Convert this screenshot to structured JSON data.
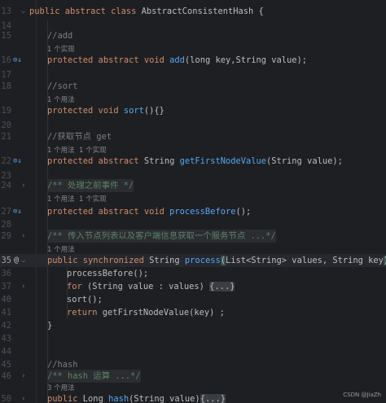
{
  "watermark": "CSDN @JiaZh",
  "lines": {
    "l13": {
      "num": "13",
      "kw1": "public abstract class ",
      "name": "AbstractConsistentHash {"
    },
    "l14": {
      "num": "14"
    },
    "l15": {
      "num": "15",
      "comment": "//add"
    },
    "hint_add": "1 个实现",
    "l16": {
      "num": "16",
      "kw": "protected abstract void ",
      "fn": "add",
      "rest": "(long key,String value);"
    },
    "l17": {
      "num": "17"
    },
    "l18": {
      "num": "18",
      "comment": "//sort"
    },
    "hint_sort": "1 个用法",
    "l19": {
      "num": "19",
      "kw": "protected void ",
      "fn": "sort",
      "rest": "(){}"
    },
    "l20": {
      "num": "20"
    },
    "l21": {
      "num": "21",
      "comment": "//获取节点 get"
    },
    "hint_get": "1 个用法  1 个实现",
    "l22": {
      "num": "22",
      "kw": "protected abstract ",
      "type": "String ",
      "fn": "getFirstNodeValue",
      "rest": "(String value);"
    },
    "l23": {
      "num": "23"
    },
    "l24": {
      "num": "24",
      "doc": "/** 处理之前事件 */"
    },
    "hint_before": "1 个用法  1 个实现",
    "l27": {
      "num": "27",
      "kw": "protected abstract void ",
      "fn": "processBefore",
      "rest": "();"
    },
    "l28": {
      "num": "28"
    },
    "l29": {
      "num": "29",
      "doc": "/** 传入节点列表以及客户端信息获取一个服务节点 ...*/"
    },
    "hint_process": "1 个用法",
    "l35": {
      "num": "35",
      "kw": "public synchronized ",
      "type": "String ",
      "fn": "process",
      "paren": "(",
      "rest": "List<String> values, String key",
      "paren2": ")",
      "brace": "{"
    },
    "l36": {
      "num": "36",
      "code": "processBefore();"
    },
    "l37": {
      "num": "37",
      "kw": "for ",
      "rest": "(String value : values) ",
      "chip": "{...}"
    },
    "l40": {
      "num": "40",
      "code": "sort();"
    },
    "l41": {
      "num": "41",
      "kw": "return ",
      "rest": "getFirstNodeValue(key) ;"
    },
    "l42": {
      "num": "42",
      "code": "}"
    },
    "l43": {
      "num": "43"
    },
    "l44": {
      "num": "44"
    },
    "l45": {
      "num": "45",
      "comment": "//hash"
    },
    "l46": {
      "num": "46",
      "doc": "/** hash 运算 ...*/"
    },
    "hint_hash": "3 个用法",
    "l50": {
      "num": "50",
      "kw": "public ",
      "type": "Long ",
      "fn": "hash",
      "rest": "(String value)",
      "chip": "{...}"
    }
  },
  "gutter_icons": {
    "implemented": "implemented-method-icon",
    "annotation": "at-icon",
    "fold": "fold-chevron-icon"
  },
  "colors": {
    "background": "#1e1f22",
    "keyword": "#cf8e6d",
    "function": "#56a8f5",
    "comment": "#7a7e85",
    "doc_comment": "#5f826b",
    "text": "#bcbec4"
  }
}
